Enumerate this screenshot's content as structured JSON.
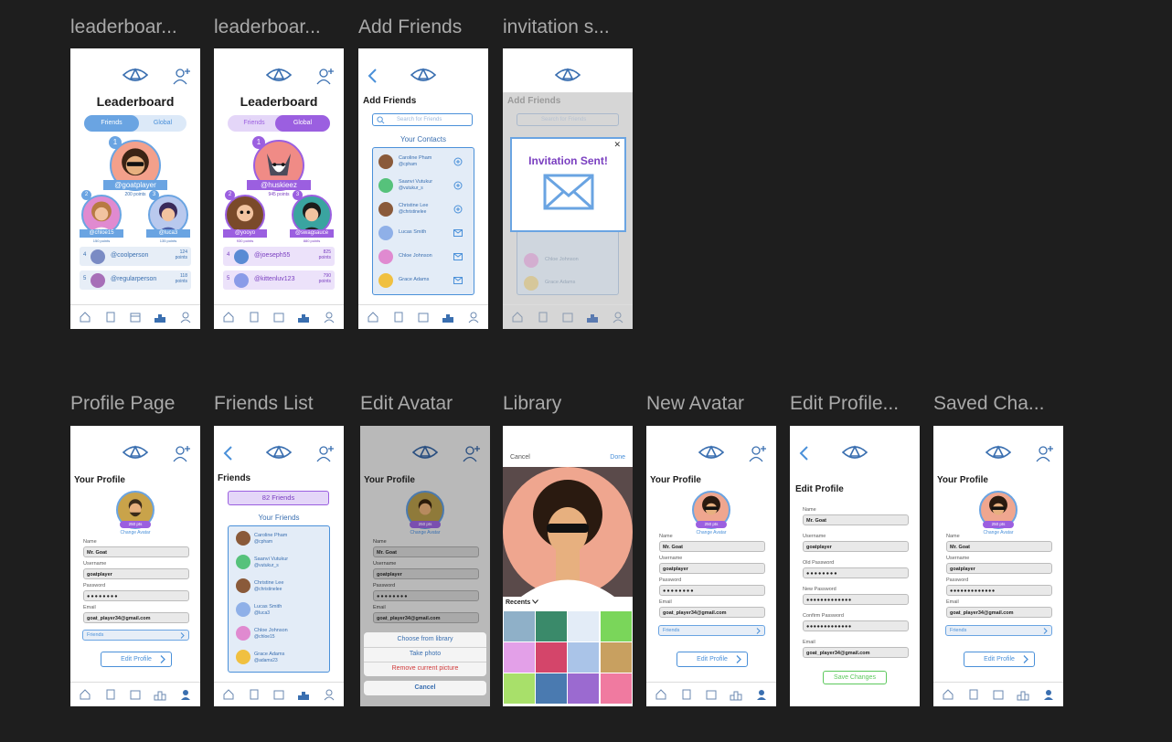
{
  "frames": {
    "lb1": {
      "title": "leaderboar...",
      "heading": "Leaderboard",
      "tab_friends": "Friends",
      "tab_global": "Global",
      "first_user": "@goatplayer",
      "first_pts": "200 points",
      "first_rank": "1",
      "second_user": "@chloe15",
      "second_pts": "150 points",
      "second_rank": "2",
      "third_user": "@luca3",
      "third_pts": "135 points",
      "third_rank": "3",
      "rows": [
        {
          "rank": "4",
          "user": "@coolperson",
          "pts": "124\npoints"
        },
        {
          "rank": "5",
          "user": "@regularperson",
          "pts": "118\npoints"
        }
      ]
    },
    "lb2": {
      "title": "leaderboar...",
      "heading": "Leaderboard",
      "tab_friends": "Friends",
      "tab_global": "Global",
      "first_user": "@huskieez",
      "first_pts": "945 points",
      "first_rank": "1",
      "second_user": "@yooyo",
      "second_pts": "930 points",
      "second_rank": "2",
      "third_user": "@swagsauce",
      "third_pts": "880 points",
      "third_rank": "3",
      "rows": [
        {
          "rank": "4",
          "user": "@joeseph55",
          "pts": "825\npoints"
        },
        {
          "rank": "5",
          "user": "@kittenluv123",
          "pts": "790\npoints"
        }
      ]
    },
    "addf": {
      "title": "Add Friends",
      "heading": "Add Friends",
      "search_placeholder": "Search for Friends",
      "section": "Your Contacts",
      "contacts": [
        {
          "name": "Caroline Pham",
          "handle": "@cpham"
        },
        {
          "name": "Saanvi Vutukur",
          "handle": "@vutukur_s"
        },
        {
          "name": "Christine Lee",
          "handle": "@christinelee"
        },
        {
          "name": "Lucas Smith",
          "handle": ""
        },
        {
          "name": "Chloe Johnson",
          "handle": ""
        },
        {
          "name": "Grace Adams",
          "handle": ""
        }
      ]
    },
    "inv": {
      "title": "invitation s...",
      "heading": "Add Friends",
      "search_placeholder": "Search for Friends",
      "modal_text": "Invitation Sent!",
      "close": "✕",
      "bg_contacts": [
        "Chloe Johnson",
        "Grace Adams"
      ]
    },
    "profile": {
      "title": "Profile Page",
      "heading": "Your Profile",
      "pts": "250 pts",
      "change_avatar": "Change Avatar",
      "name_label": "Name",
      "name": "Mr. Goat",
      "username_label": "Username",
      "username": "goatplayer",
      "password_label": "Password",
      "password": "●●●●●●●●",
      "email_label": "Email",
      "email": "goat_player34@gmail.com",
      "friends": "Friends",
      "edit": "Edit Profile"
    },
    "flist": {
      "title": "Friends List",
      "heading": "Friends",
      "count": "82 Friends",
      "section": "Your Friends",
      "friends": [
        {
          "name": "Caroline Pham",
          "handle": "@cpham"
        },
        {
          "name": "Saanvi Vutukur",
          "handle": "@vutukur_s"
        },
        {
          "name": "Christine Lee",
          "handle": "@christinelee"
        },
        {
          "name": "Lucas Smith",
          "handle": "@luca3"
        },
        {
          "name": "Chloe Johnson",
          "handle": "@chloe15"
        },
        {
          "name": "Grace Adams",
          "handle": "@adams23"
        }
      ]
    },
    "editav": {
      "title": "Edit Avatar",
      "heading": "Your Profile",
      "pts": "250 pts",
      "change_avatar": "Change Avatar",
      "name_label": "Name",
      "name": "Mr. Goat",
      "username_label": "Username",
      "username": "goatplayer",
      "password_label": "Password",
      "password": "●●●●●●●●",
      "email_label": "Email",
      "email": "goat_player34@gmail.com",
      "opt1": "Choose from library",
      "opt2": "Take photo",
      "opt3": "Remove current picture",
      "cancel": "Cancel"
    },
    "library": {
      "title": "Library",
      "cancel": "Cancel",
      "done": "Done",
      "recents": "Recents"
    },
    "newav": {
      "title": "New Avatar",
      "heading": "Your Profile",
      "pts": "250 pts",
      "change_avatar": "Change Avatar",
      "name_label": "Name",
      "name": "Mr. Goat",
      "username_label": "Username",
      "username": "goatplayer",
      "password_label": "Password",
      "password": "●●●●●●●●",
      "email_label": "Email",
      "email": "goat_player34@gmail.com",
      "friends": "Friends",
      "edit": "Edit Profile"
    },
    "editprof": {
      "title": "Edit Profile...",
      "heading": "Edit Profile",
      "name_label": "Name",
      "name": "Mr. Goat",
      "username_label": "Username",
      "username": "goatplayer",
      "old_label": "Old Password",
      "old": "●●●●●●●●",
      "new_label": "New Password",
      "new": "●●●●●●●●●●●●●",
      "confirm_label": "Confirm Password",
      "confirm": "●●●●●●●●●●●●●",
      "email_label": "Email",
      "email": "goat_player34@gmail.com",
      "save": "Save Changes"
    },
    "saved": {
      "title": "Saved Cha...",
      "heading": "Your Profile",
      "pts": "250 pts",
      "change_avatar": "Change Avatar",
      "name_label": "Name",
      "name": "Mr. Goat",
      "username_label": "Username",
      "username": "goatplayer",
      "password_label": "Password",
      "password": "●●●●●●●●●●●●●",
      "email_label": "Email",
      "email": "goat_player34@gmail.com",
      "friends": "Friends",
      "edit": "Edit Profile"
    }
  },
  "colors": {
    "accent_blue": "#4a90d9",
    "light_blue": "#dce9f8",
    "purple": "#9b5fe0",
    "light_purple": "#e4d6f8",
    "canvas": "#1e1e1e",
    "green": "#5cc85c"
  },
  "icons": [
    "eye-logo-icon",
    "add-user-icon",
    "back-chevron-icon",
    "home-icon",
    "book-icon",
    "calendar-icon",
    "leaderboard-icon",
    "profile-icon",
    "search-icon",
    "add-circle-icon",
    "mail-icon",
    "envelope-icon",
    "close-icon",
    "chevron-right-icon",
    "chevron-down-icon"
  ]
}
